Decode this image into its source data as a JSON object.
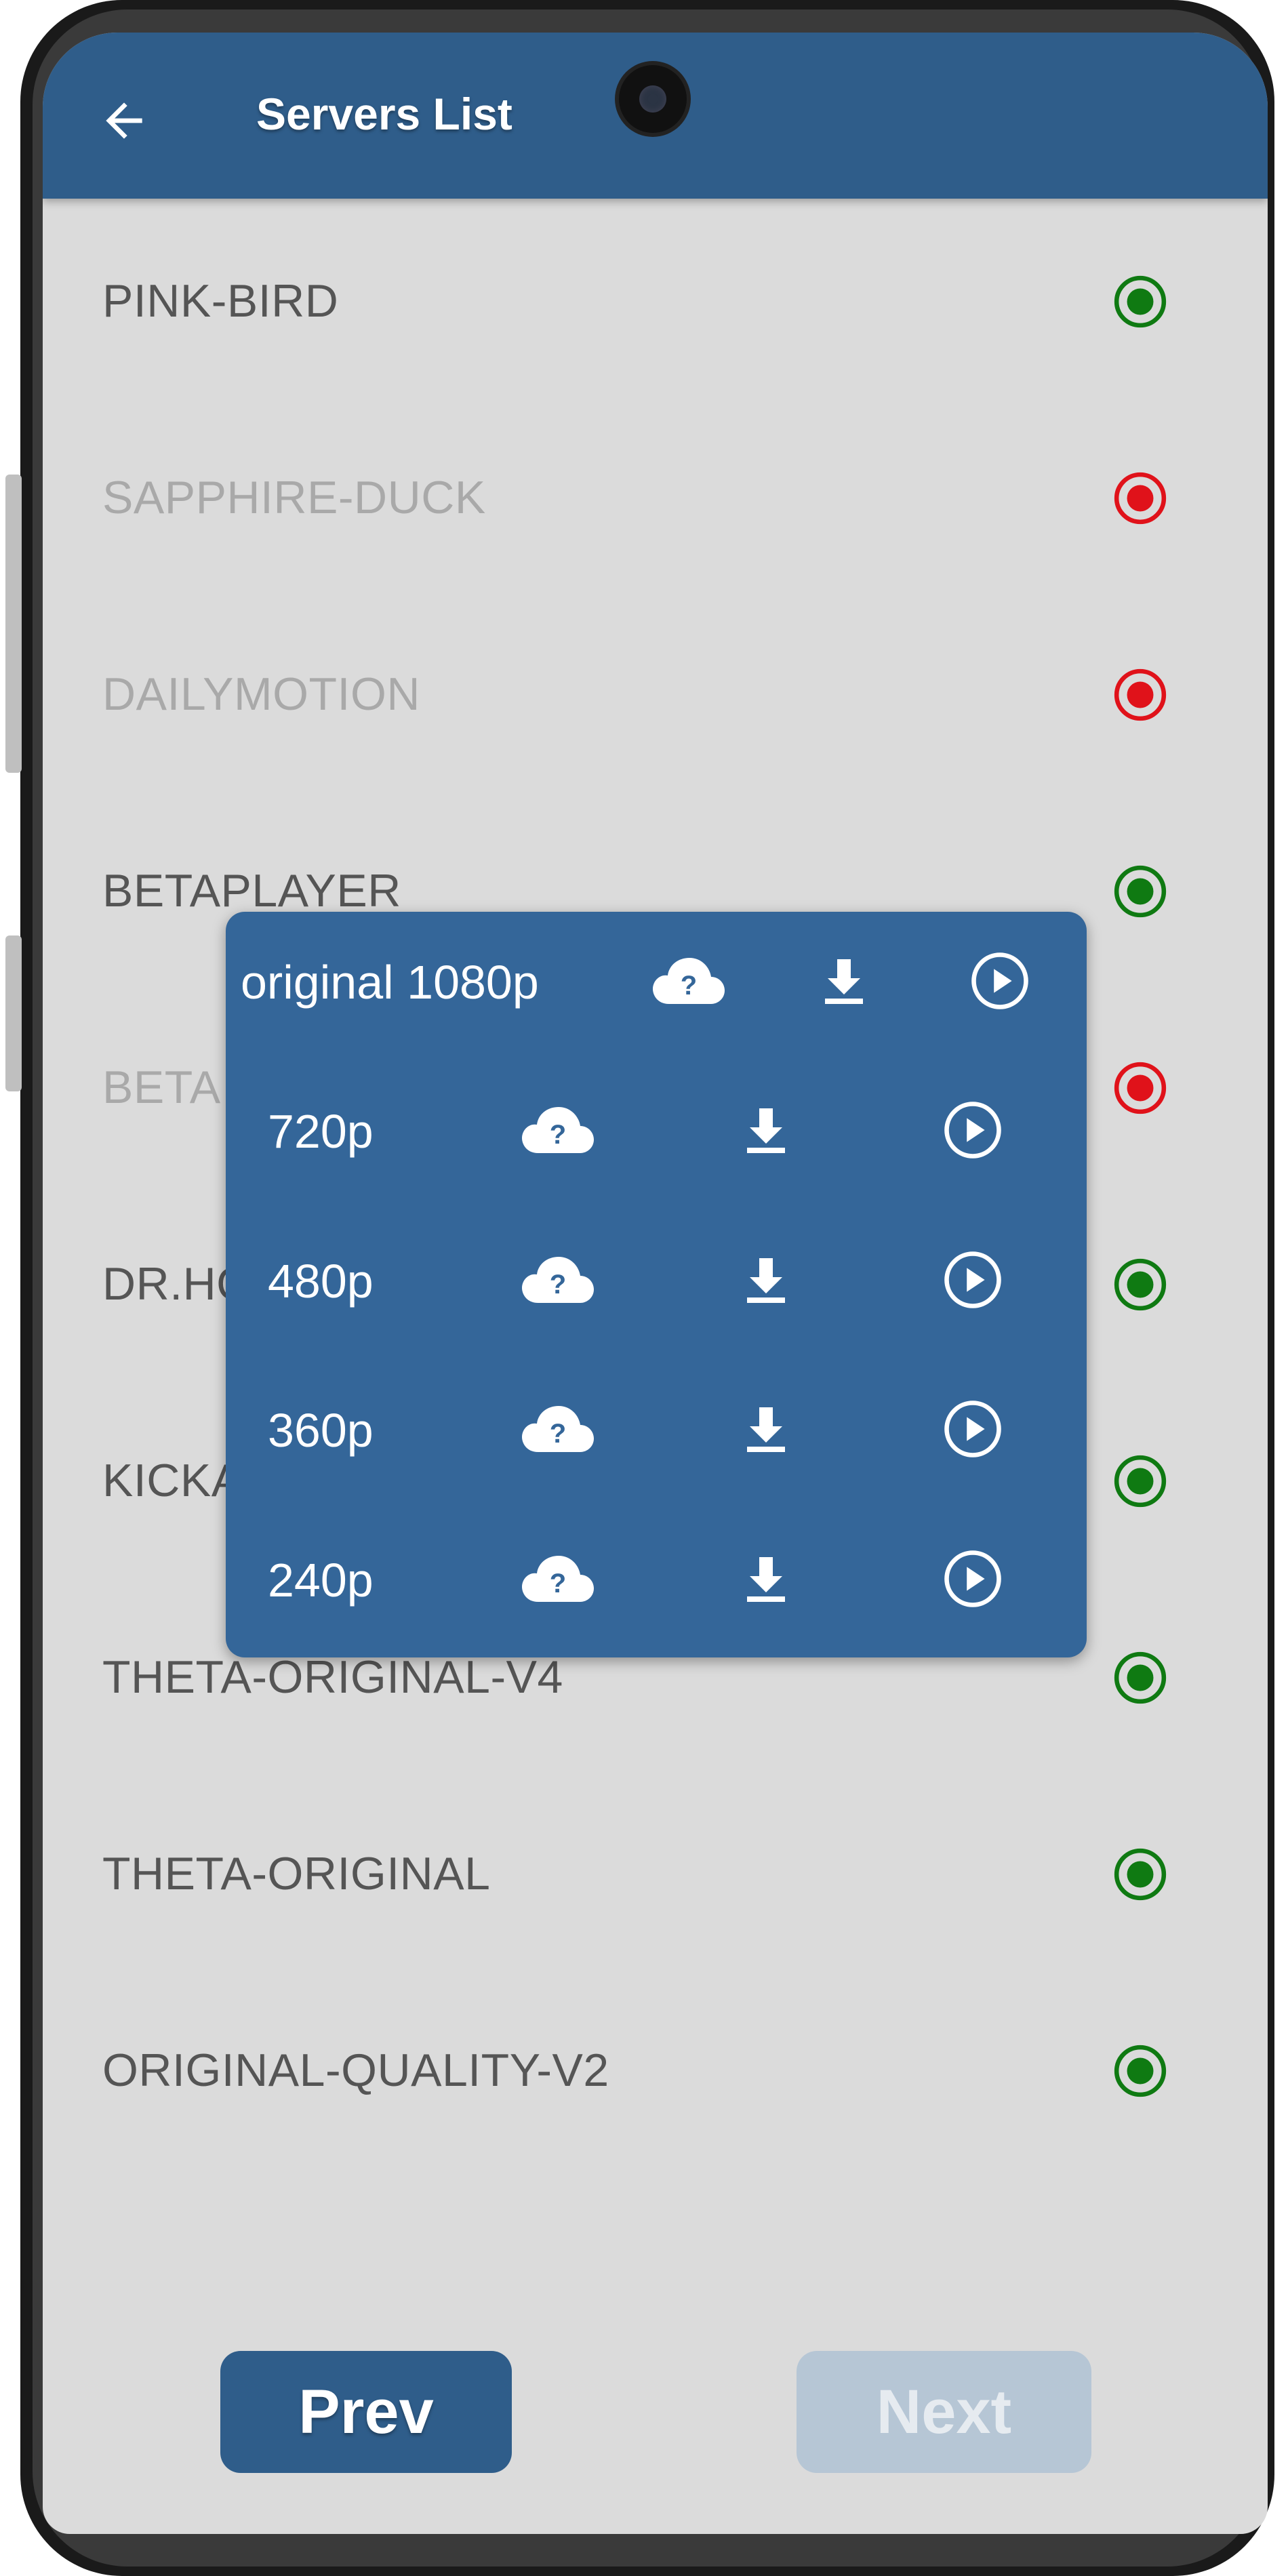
{
  "header": {
    "title": "Servers List",
    "back_icon": "arrow-left-icon"
  },
  "servers": [
    {
      "name": "PINK-BIRD",
      "status": "online"
    },
    {
      "name": "SAPPHIRE-DUCK",
      "status": "offline"
    },
    {
      "name": "DAILYMOTION",
      "status": "offline"
    },
    {
      "name": "BETAPLAYER",
      "status": "online"
    },
    {
      "name": "BETA",
      "status": "offline"
    },
    {
      "name": "DR.HO",
      "status": "online"
    },
    {
      "name": "KICKA",
      "status": "online"
    },
    {
      "name": "THETA-ORIGINAL-V4",
      "status": "online"
    },
    {
      "name": "THETA-ORIGINAL",
      "status": "online"
    },
    {
      "name": "ORIGINAL-QUALITY-V2",
      "status": "online"
    }
  ],
  "quality_popup": {
    "options": [
      {
        "label": "original 1080p"
      },
      {
        "label": "720p"
      },
      {
        "label": "480p"
      },
      {
        "label": "360p"
      },
      {
        "label": "240p"
      }
    ],
    "icons": [
      "cloud-question-icon",
      "download-icon",
      "play-circle-icon"
    ]
  },
  "footer": {
    "prev_label": "Prev",
    "next_label": "Next"
  },
  "colors": {
    "primary": "#2f5d8a",
    "popup": "#346699",
    "online": "#0f7a12",
    "offline": "#e0121a",
    "background": "#dbdbdb"
  }
}
